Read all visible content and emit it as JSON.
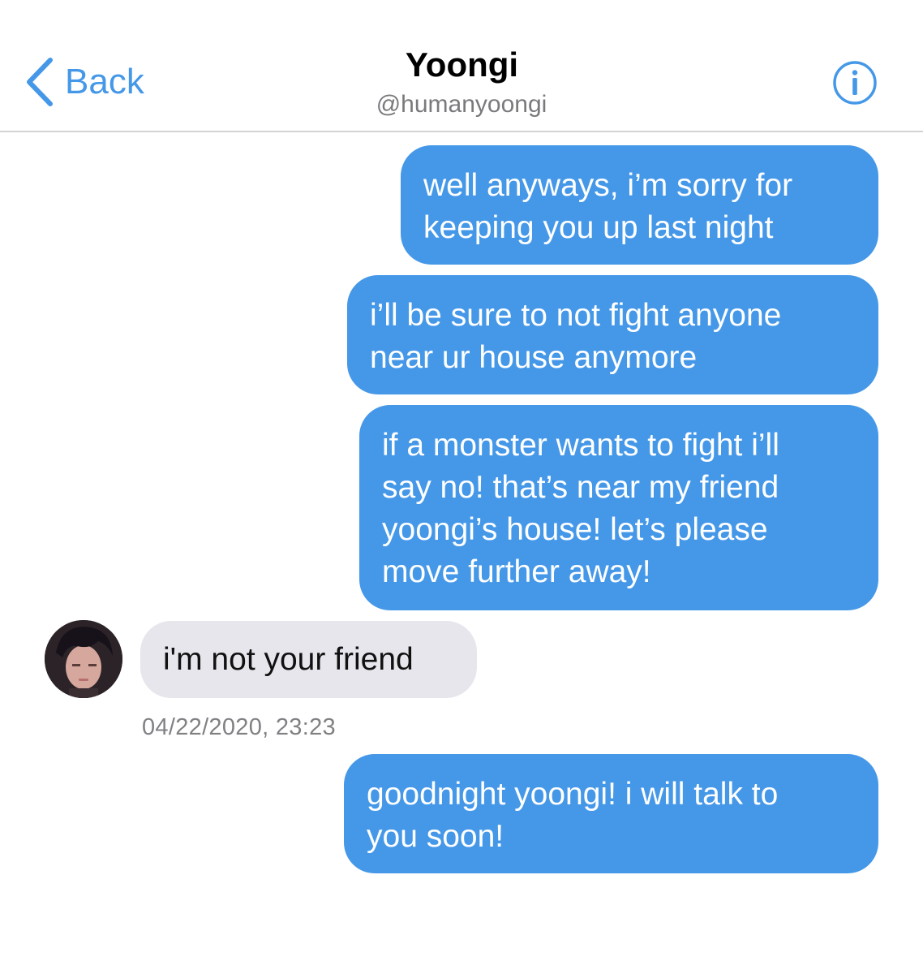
{
  "header": {
    "back_label": "Back",
    "contact_name": "Yoongi",
    "contact_handle": "@humanyoongi",
    "back_icon": "chevron-left-icon",
    "info_icon": "info-circle-icon"
  },
  "conversation": {
    "messages": [
      {
        "direction": "sent",
        "text": "well anyways, i’m sorry for\nkeeping you up last night"
      },
      {
        "direction": "sent",
        "text": "i’ll be sure to not fight anyone\nnear ur house anymore"
      },
      {
        "direction": "sent",
        "text": "if a monster wants to fight i’ll\nsay no! that’s near my friend\nyoongi’s house! let’s please\nmove further away!"
      },
      {
        "direction": "received",
        "text": "i'm not your friend"
      },
      {
        "direction": "sent",
        "text": "goodnight yoongi! i will talk to\nyou soon!"
      }
    ],
    "timestamp": "04/22/2020, 23:23"
  },
  "colors": {
    "accent": "#4598e8",
    "sent_bubble": "#4598e8",
    "received_bubble": "#e6e6ec",
    "divider": "#d3d3d6",
    "secondary_text": "#7a7a7e"
  }
}
